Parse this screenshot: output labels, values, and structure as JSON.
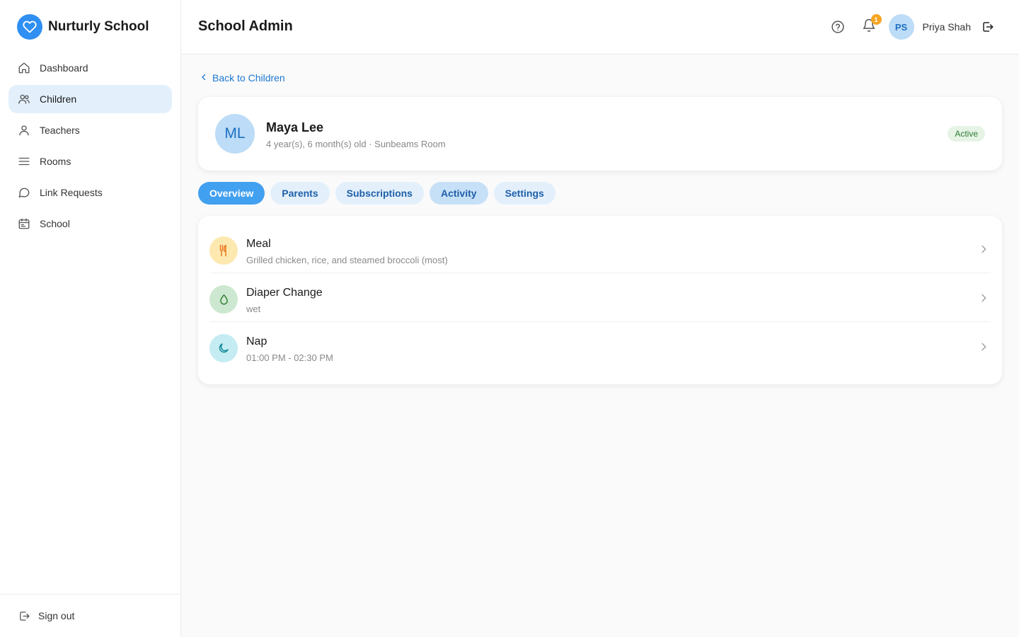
{
  "brand": {
    "name": "Nurturly School",
    "icon": "heart-icon",
    "color": "#2f8ff2"
  },
  "sidebar": {
    "items": [
      {
        "label": "Dashboard",
        "icon": "home-icon",
        "active": false
      },
      {
        "label": "Children",
        "icon": "users-icon",
        "active": true
      },
      {
        "label": "Teachers",
        "icon": "user-icon",
        "active": false
      },
      {
        "label": "Rooms",
        "icon": "menu-icon",
        "active": false
      },
      {
        "label": "Link Requests",
        "icon": "message-icon",
        "active": false
      },
      {
        "label": "School",
        "icon": "calendar-icon",
        "active": false
      }
    ],
    "sign_out": "Sign out"
  },
  "header": {
    "title": "School Admin",
    "notification_count": "1",
    "user": {
      "initials": "PS",
      "name": "Priya Shah"
    }
  },
  "main": {
    "back_label": "Back to Children",
    "child": {
      "initials": "ML",
      "name": "Maya Lee",
      "subtitle": "4 year(s), 6 month(s) old · Sunbeams Room",
      "status": "Active"
    },
    "tabs": [
      {
        "label": "Overview"
      },
      {
        "label": "Parents"
      },
      {
        "label": "Subscriptions"
      },
      {
        "label": "Activity"
      },
      {
        "label": "Settings"
      }
    ],
    "activities": [
      {
        "title": "Meal",
        "detail": "Grilled chicken, rice, and steamed broccoli (most)",
        "icon": "utensils-icon",
        "bg": "#fde9b0",
        "fg": "#e8741c"
      },
      {
        "title": "Diaper Change",
        "detail": "wet",
        "icon": "droplet-icon",
        "bg": "#cde8d0",
        "fg": "#2e7d32"
      },
      {
        "title": "Nap",
        "detail": "01:00 PM - 02:30 PM",
        "icon": "moon-icon",
        "bg": "#c4ecf2",
        "fg": "#138a9a"
      }
    ]
  },
  "colors": {
    "accent": "#42a0f0",
    "active_nav": "#e3f0fc",
    "badge": "#f5a623",
    "link": "#1e78d2"
  }
}
